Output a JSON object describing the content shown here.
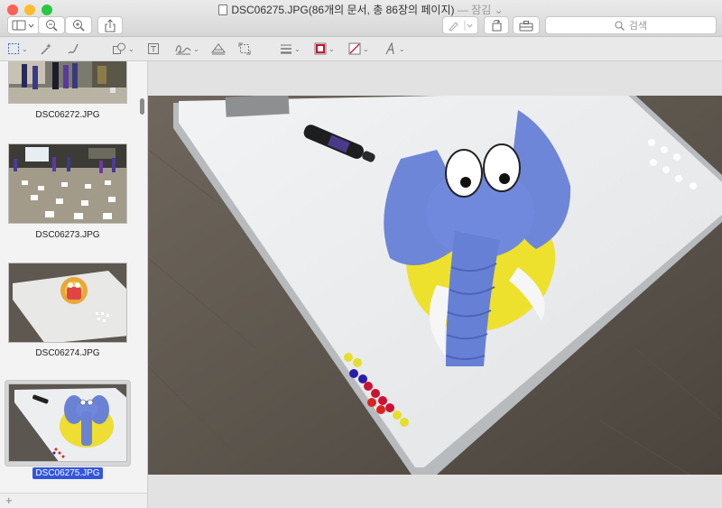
{
  "window": {
    "title": "DSC06275.JPG(86개의 문서, 총 86장의 페이지)",
    "title_status": "— 잠김",
    "title_caret": "⌄"
  },
  "toolbar": {
    "search_placeholder": "검색"
  },
  "sidebar": {
    "thumbnails": [
      {
        "label": "DSC06272.JPG"
      },
      {
        "label": "DSC06273.JPG"
      },
      {
        "label": "DSC06274.JPG"
      },
      {
        "label": "DSC06275.JPG",
        "selected": true
      }
    ],
    "add_label": "+"
  },
  "colors": {
    "selection": "#3355dd",
    "close_light": "#fe5f57",
    "minimize_light": "#febc2e",
    "zoom_light": "#28c840",
    "border_color_swatch": "#cc1133"
  }
}
